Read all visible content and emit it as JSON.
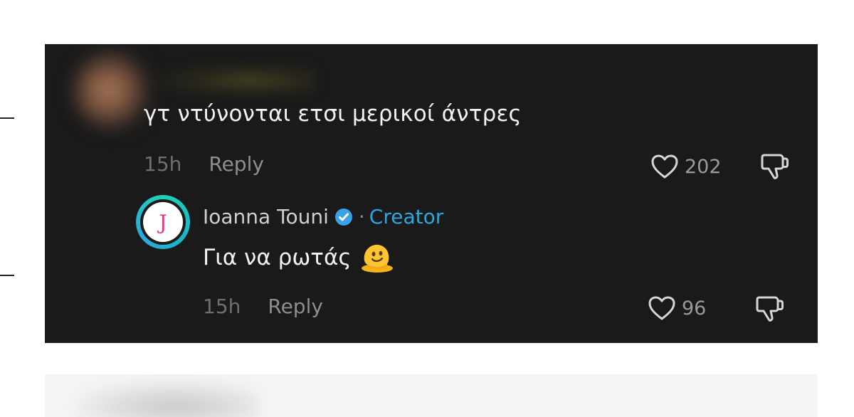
{
  "comment1": {
    "text": "γτ ντύνονται ετσι μερικοί άντρες",
    "time": "15h",
    "reply_label": "Reply",
    "like_count": "202"
  },
  "comment2": {
    "author": "Ioanna Touni",
    "separator": "·",
    "badge": "Creator",
    "avatar_letter": "J",
    "text": "Για να ρωτάς",
    "emoji": "melting-face-icon",
    "time": "15h",
    "reply_label": "Reply",
    "like_count": "96"
  },
  "colors": {
    "panel_bg": "#1a1a1a",
    "creator_accent": "#2aa7de",
    "verified_badge": "#3aa0e8",
    "avatar_ring": "#1fd1b6"
  }
}
